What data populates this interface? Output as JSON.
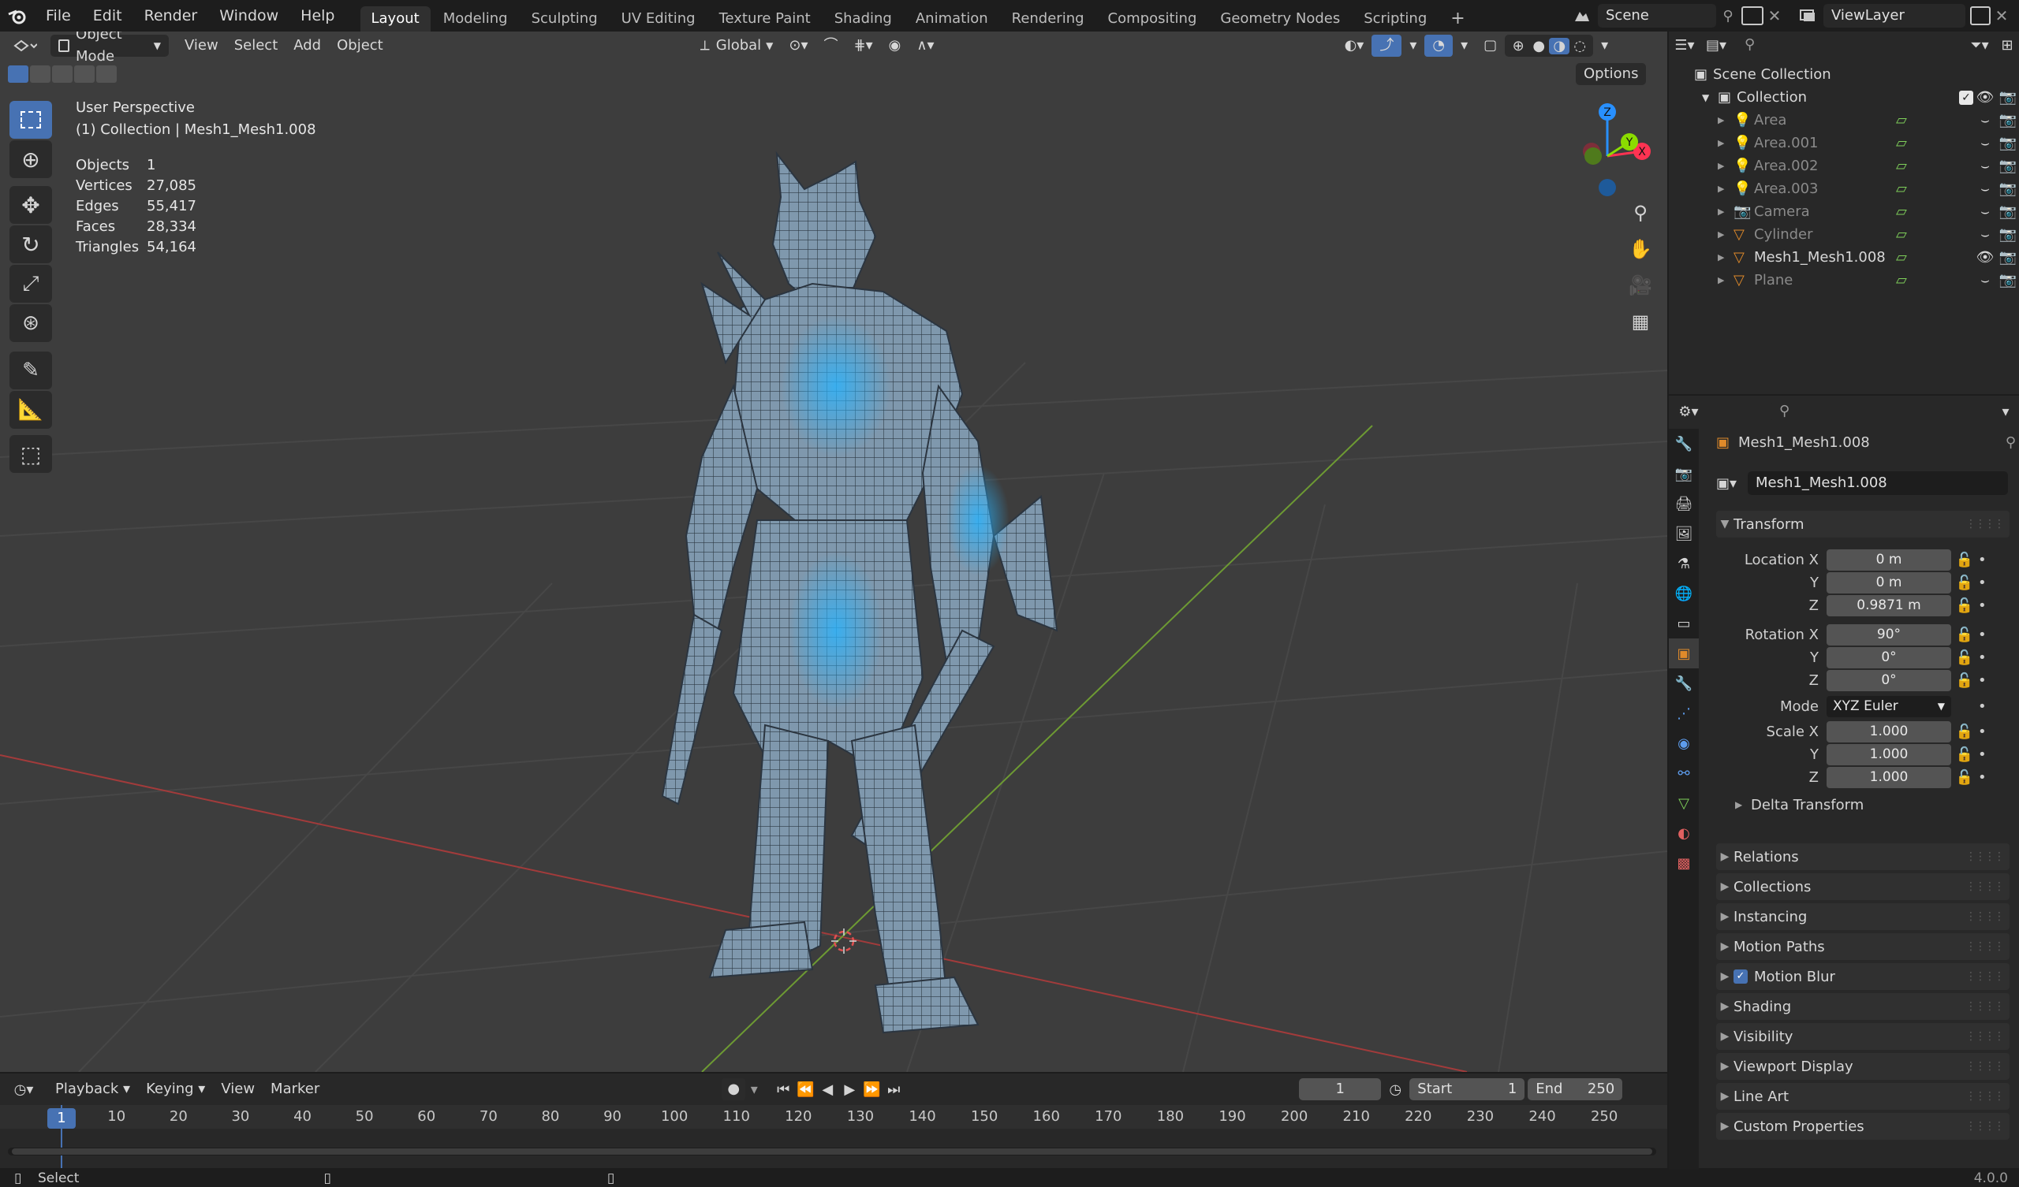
{
  "topbar": {
    "menus": [
      "File",
      "Edit",
      "Render",
      "Window",
      "Help"
    ],
    "workspaces": [
      "Layout",
      "Modeling",
      "Sculpting",
      "UV Editing",
      "Texture Paint",
      "Shading",
      "Animation",
      "Rendering",
      "Compositing",
      "Geometry Nodes",
      "Scripting"
    ],
    "active_workspace": "Layout",
    "scene": "Scene",
    "view_layer": "ViewLayer"
  },
  "viewport_header": {
    "mode": "Object Mode",
    "menus": [
      "View",
      "Select",
      "Add",
      "Object"
    ],
    "orientation": "Global",
    "options": "Options"
  },
  "overlay": {
    "view_name": "User Perspective",
    "collection_line": "(1) Collection | Mesh1_Mesh1.008",
    "stats": [
      {
        "label": "Objects",
        "value": "1"
      },
      {
        "label": "Vertices",
        "value": "27,085"
      },
      {
        "label": "Edges",
        "value": "55,417"
      },
      {
        "label": "Faces",
        "value": "28,334"
      },
      {
        "label": "Triangles",
        "value": "54,164"
      }
    ]
  },
  "gizmo": {
    "x": "X",
    "y": "Y",
    "z": "Z"
  },
  "outliner": {
    "scene_collection": "Scene Collection",
    "collection": "Collection",
    "items": [
      {
        "name": "Area",
        "active": false
      },
      {
        "name": "Area.001",
        "active": false
      },
      {
        "name": "Area.002",
        "active": false
      },
      {
        "name": "Area.003",
        "active": false
      },
      {
        "name": "Camera",
        "active": false
      },
      {
        "name": "Cylinder",
        "active": false
      },
      {
        "name": "Mesh1_Mesh1.008",
        "active": true
      },
      {
        "name": "Plane",
        "active": false
      }
    ]
  },
  "properties": {
    "object_name": "Mesh1_Mesh1.008",
    "object_field": "Mesh1_Mesh1.008",
    "transform": {
      "title": "Transform",
      "location_label": "Location X",
      "loc_x": "0 m",
      "loc_y": "0 m",
      "loc_z": "0.9871 m",
      "rotation_label": "Rotation X",
      "rot_x": "90°",
      "rot_y": "0°",
      "rot_z": "0°",
      "mode_label": "Mode",
      "mode_value": "XYZ Euler",
      "scale_label": "Scale X",
      "scale_x": "1.000",
      "scale_y": "1.000",
      "scale_z": "1.000",
      "y_label": "Y",
      "z_label": "Z",
      "delta": "Delta Transform"
    },
    "panels": [
      "Relations",
      "Collections",
      "Instancing",
      "Motion Paths",
      "Motion Blur",
      "Shading",
      "Visibility",
      "Viewport Display",
      "Line Art",
      "Custom Properties"
    ]
  },
  "timeline": {
    "menus": [
      "Playback",
      "Keying",
      "View",
      "Marker"
    ],
    "current_frame": "1",
    "start_label": "Start",
    "start": "1",
    "end_label": "End",
    "end": "250",
    "ticks": [
      "1",
      "10",
      "20",
      "30",
      "40",
      "50",
      "60",
      "70",
      "80",
      "90",
      "100",
      "110",
      "120",
      "130",
      "140",
      "150",
      "160",
      "170",
      "180",
      "190",
      "200",
      "210",
      "220",
      "230",
      "240",
      "250"
    ]
  },
  "status": {
    "left": "Select",
    "version": "4.0.0"
  },
  "colors": {
    "accent": "#4772b3",
    "axis_x": "#ff3352",
    "axis_y": "#8bdc00",
    "axis_z": "#2890ff"
  }
}
